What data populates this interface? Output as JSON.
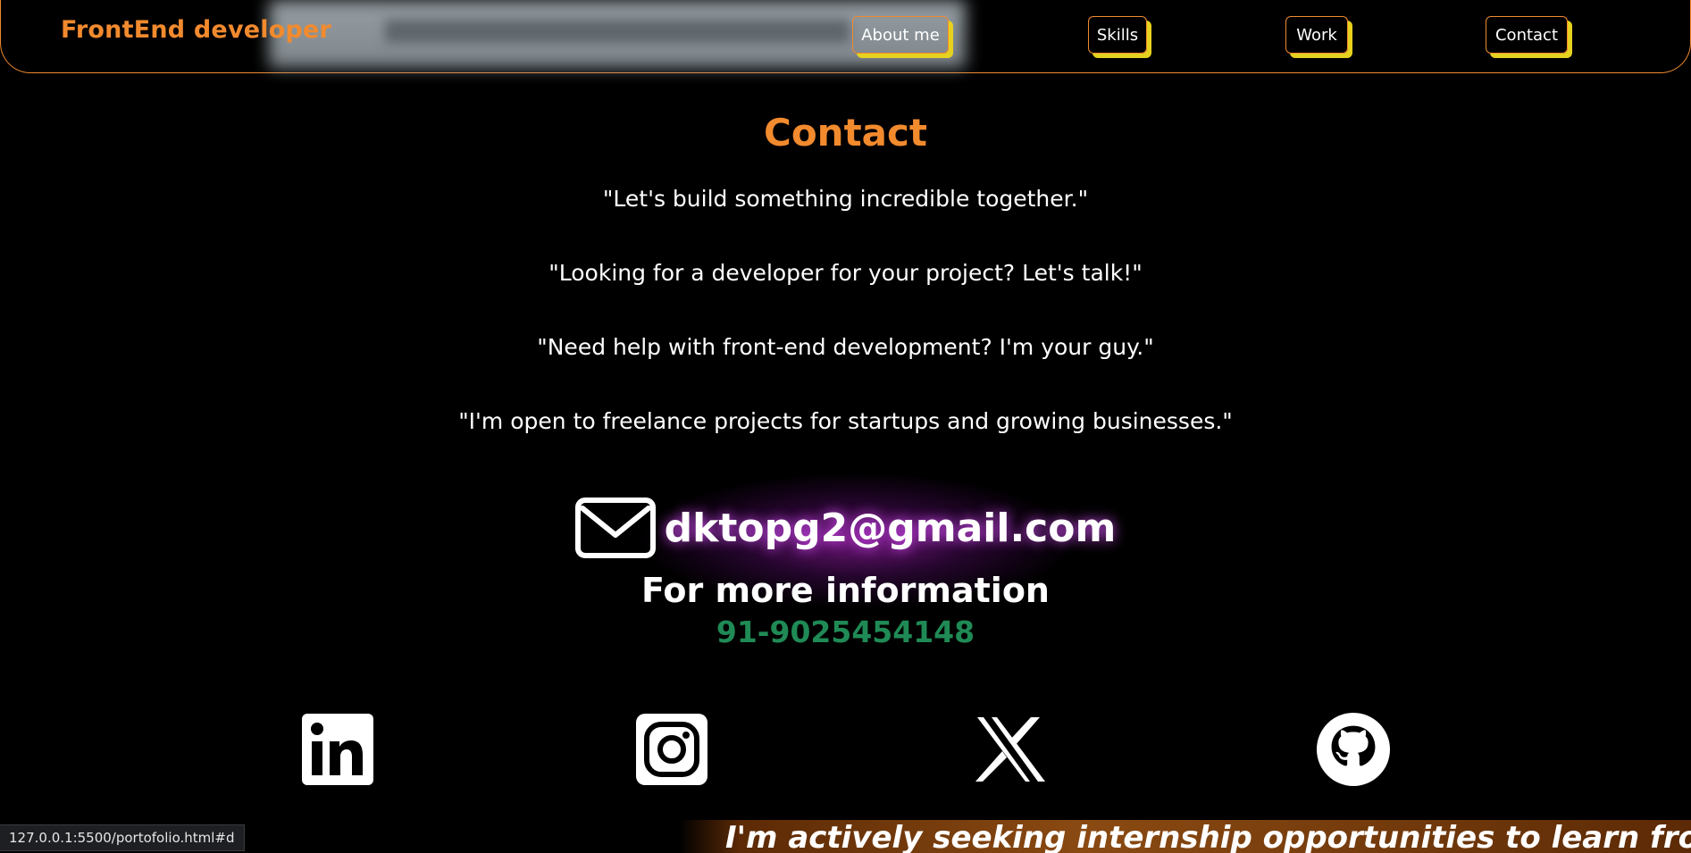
{
  "nav": {
    "brand": "FrontEnd developer",
    "links": [
      "About me",
      "Skills",
      "Work",
      "Contact"
    ]
  },
  "contact": {
    "title": "Contact",
    "quotes": [
      "\"Let's build something incredible together.\"",
      "\"Looking for a developer for your project? Let's talk!\"",
      "\"Need help with front-end development? I'm your guy.\"",
      "\"I'm open to freelance projects for startups and growing businesses.\""
    ],
    "email": "dktopg2@gmail.com",
    "more_info": "For more information",
    "phone": "91-9025454148"
  },
  "socials": [
    "linkedin-icon",
    "instagram-icon",
    "x-icon",
    "github-icon"
  ],
  "marquee": {
    "text": "I'm actively seeking internship opportunities to learn from e"
  },
  "status_bar": {
    "url": "127.0.0.1:5500/portofolio.html#d"
  },
  "colors": {
    "accent": "#f28a2e",
    "button_shadow": "#e6d21e",
    "phone": "#1f8a55",
    "background": "#000000"
  }
}
